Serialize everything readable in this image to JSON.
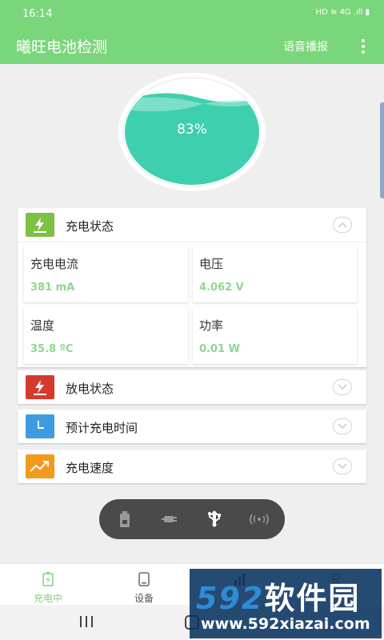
{
  "status_bar": {
    "time": "16:14",
    "indicators": "HD ≋ 4G .ıll ▮"
  },
  "app_bar": {
    "title": "曦旺电池检测",
    "voice_label": "语音播报"
  },
  "battery": {
    "percent_text": "83%",
    "level": 0.83,
    "fill_color": "#3ecfae"
  },
  "cards": {
    "charging_status": {
      "title": "充电状态",
      "expanded": true,
      "metrics": [
        {
          "label": "充电电流",
          "value": "381 mA"
        },
        {
          "label": "电压",
          "value": "4.062 V"
        },
        {
          "label": "温度",
          "value": "35.8 ºC"
        },
        {
          "label": "功率",
          "value": "0.01 W"
        }
      ]
    },
    "discharge_status": {
      "title": "放电状态"
    },
    "estimated_time": {
      "title": "预计充电时间"
    },
    "charge_speed": {
      "title": "充电速度"
    }
  },
  "mode_bar": {
    "selected": "usb",
    "items": [
      "battery-icon",
      "plug-icon",
      "usb-icon",
      "wireless-icon"
    ]
  },
  "bottom_nav": {
    "items": [
      {
        "label": "充电中",
        "icon": "battery-charging-icon",
        "active": true
      },
      {
        "label": "设备",
        "icon": "device-icon",
        "active": false
      },
      {
        "label": "",
        "icon": "stats-icon",
        "active": false
      },
      {
        "label": "",
        "icon": "user-icon",
        "active": false
      }
    ]
  },
  "watermark": {
    "brand_digits": "592",
    "brand_text": "软件园",
    "url": "www.592xiazai.com"
  },
  "colors": {
    "primary": "#7ad67a",
    "value_green": "#8ed78e",
    "gauge_fill": "#3ecfae"
  }
}
